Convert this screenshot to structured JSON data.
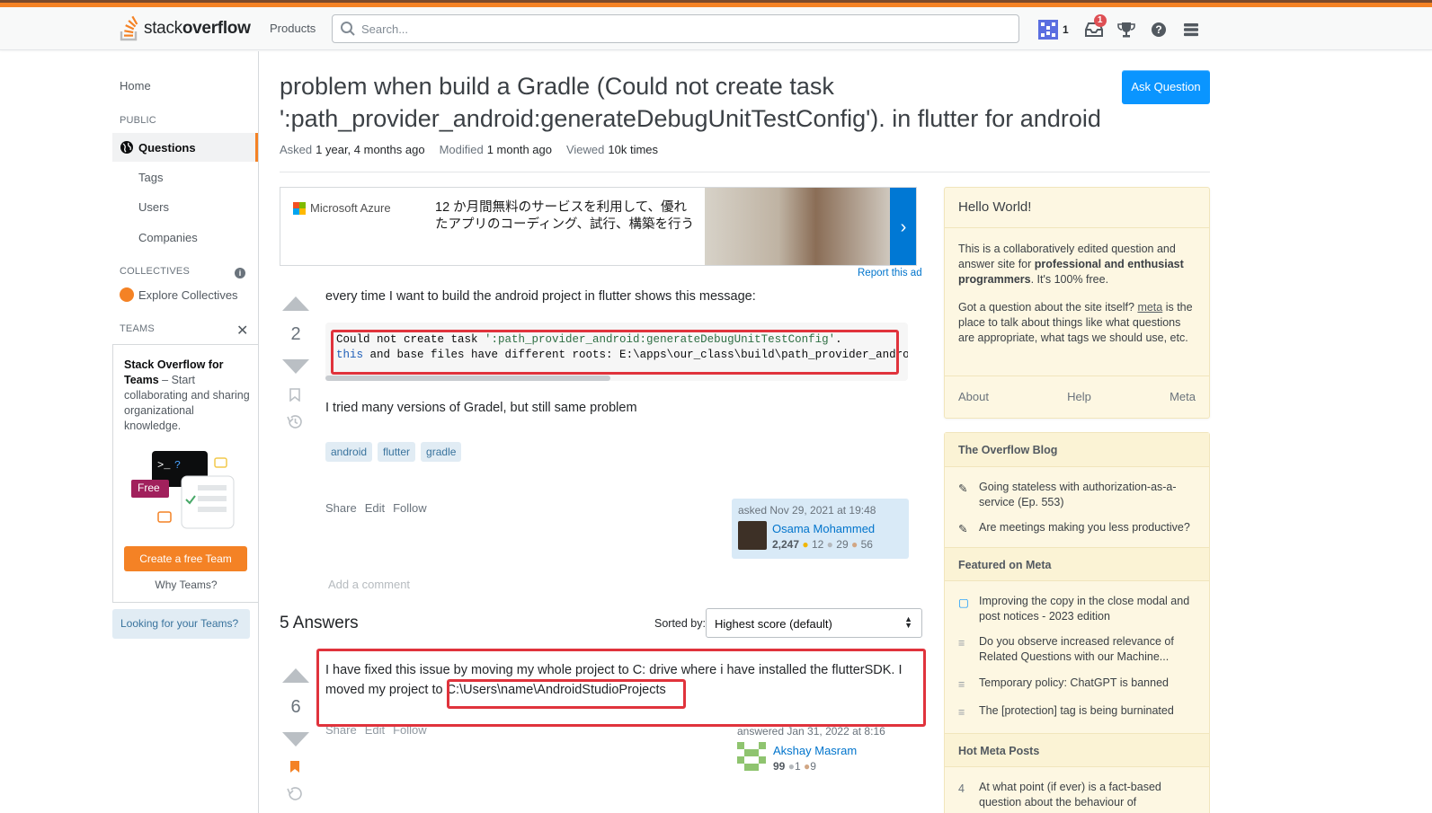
{
  "header": {
    "logo_light": "stack",
    "logo_bold": "overflow",
    "products": "Products",
    "search_placeholder": "Search...",
    "reputation": "1",
    "inbox_count": "1"
  },
  "sidebar": {
    "home": "Home",
    "public_heading": "PUBLIC",
    "questions": "Questions",
    "tags": "Tags",
    "users": "Users",
    "companies": "Companies",
    "collectives_heading": "COLLECTIVES",
    "explore_collectives": "Explore Collectives",
    "teams_heading": "TEAMS",
    "teams_title_bold": "Stack Overflow for Teams",
    "teams_desc": " – Start collaborating and sharing organizational knowledge.",
    "free_badge": "Free",
    "create_team": "Create a free Team",
    "why_teams": "Why Teams?",
    "looking": "Looking for your Teams?"
  },
  "question": {
    "title": "problem when build a Gradle (Could not create task ':path_provider_android:generateDebugUnitTestConfig'). in flutter for android",
    "asked_label": "Asked",
    "asked_value": "1 year, 4 months ago",
    "modified_label": "Modified",
    "modified_value": "1 month ago",
    "viewed_label": "Viewed",
    "viewed_value": "10k times",
    "score": "2",
    "body_intro": "every time I want to build the android project in flutter shows this message:",
    "code_line1_a": "Could not create task ",
    "code_line1_b": "':path_provider_android:generateDebugUnitTestConfig'",
    "code_line1_c": ".",
    "code_line2_a": "this",
    "code_line2_b": " and base files have different roots: E:\\apps\\our_class\\build\\path_provider_andro",
    "body_outro": "I tried many versions of Gradel, but still same problem",
    "tags": [
      "android",
      "flutter",
      "gradle"
    ],
    "menu": [
      "Share",
      "Edit",
      "Follow"
    ],
    "asked_time": "asked Nov 29, 2021 at 19:48",
    "owner_name": "Osama Mohammed",
    "owner_rep": "2,247",
    "owner_gold": "12",
    "owner_silver": "29",
    "owner_bronze": "56",
    "add_comment": "Add a comment"
  },
  "ad": {
    "brand": "Microsoft Azure",
    "text": "12 か月間無料のサービスを利用して、優れたアプリのコーディング、試行、構築を行う",
    "report": "Report this ad"
  },
  "ask_button": "Ask Question",
  "answers": {
    "count_label": "5 Answers",
    "sorted_by": "Sorted by:",
    "sort_value": "Highest score (default)",
    "top": {
      "score": "6",
      "text_a": "I have fixed this issue by moving my whole project to C: drive where i have installed the flutterSDK. I moved my project to ",
      "text_b": "C:\\Users\\name\\AndroidStudioProjects",
      "menu": [
        "Share",
        "Edit",
        "Follow"
      ],
      "answered_time": "answered Jan 31, 2022 at 8:16",
      "author": "Akshay Masram",
      "rep": "99",
      "silver": "1",
      "bronze": "9"
    }
  },
  "hello": {
    "title": "Hello World!",
    "p1_a": "This is a collaboratively edited question and answer site for ",
    "p1_bold": "professional and enthusiast programmers",
    "p1_b": ". It's 100% free.",
    "p2_a": "Got a question about the site itself? ",
    "p2_link": "meta",
    "p2_b": " is the place to talk about things like what questions are appropriate, what tags we should use, etc.",
    "footer": [
      "About",
      "Help",
      "Meta"
    ]
  },
  "blog": {
    "heading": "The Overflow Blog",
    "items": [
      "Going stateless with authorization-as-a-service (Ep. 553)",
      "Are meetings making you less productive?"
    ],
    "featured_heading": "Featured on Meta",
    "featured": [
      "Improving the copy in the close modal and post notices - 2023 edition",
      "Do you observe increased relevance of Related Questions with our Machine...",
      "Temporary policy: ChatGPT is banned",
      "The [protection] tag is being burninated"
    ],
    "hot_heading": "Hot Meta Posts",
    "hot_num": "4",
    "hot_item": "At what point (if ever) is a fact-based question about the behaviour of"
  },
  "colors": {
    "orange": "#f48225",
    "blue_button": "#0a95ff",
    "highlight_red": "#e0333c"
  }
}
